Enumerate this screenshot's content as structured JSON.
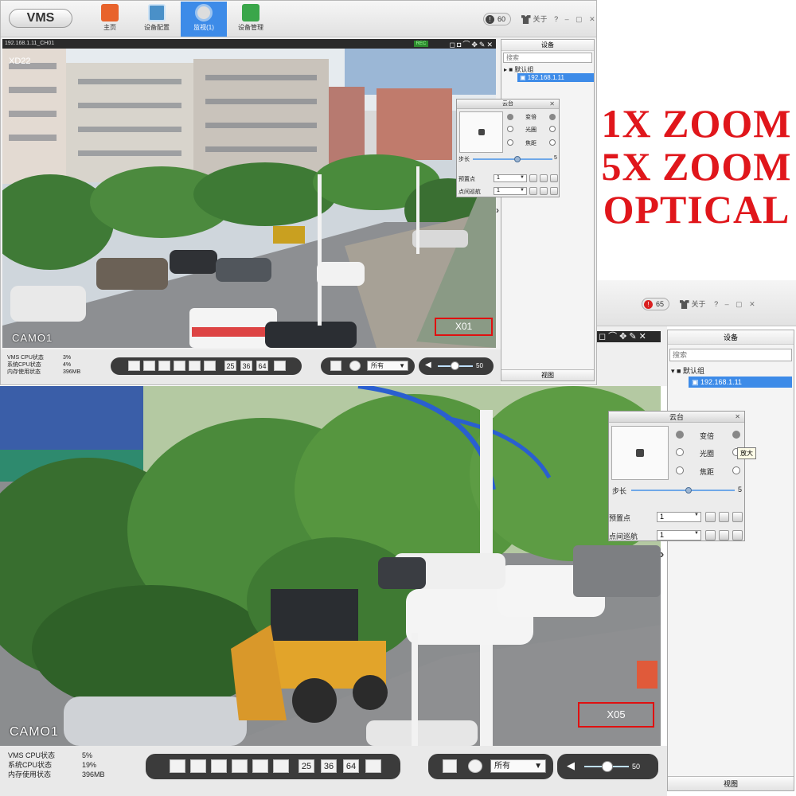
{
  "headline": {
    "line1": "1X ZOOM",
    "line2": "5X ZOOM",
    "line3": "OPTICAL"
  },
  "app": {
    "logo": "VMS"
  },
  "nav": {
    "home": "主页",
    "device_config": "设备配置",
    "preview": "监视(1)",
    "device_manage": "设备管理"
  },
  "win1": {
    "badge_count": "60",
    "about": "关于",
    "help": "?",
    "video_title": "192.168.1.11_CH01",
    "rec_label": "REC",
    "timestamp": "XD22",
    "cam_label": "CAMO1",
    "zoom_label": "X01",
    "device_title": "设备",
    "search_placeholder": "搜索",
    "group": "默认组",
    "device_item": "192.168.1.11",
    "stats": {
      "cpu_label": "VMS CPU状态",
      "cpu": "3%",
      "sys_label": "系统CPU状态",
      "sys": "4%",
      "mem_label": "内存使用状态",
      "mem": "396MB"
    },
    "grid_nums": [
      "25",
      "36",
      "64"
    ],
    "select_value": "所有",
    "volume": "50"
  },
  "win2": {
    "badge_count": "65",
    "about": "关于",
    "help": "?",
    "cam_label": "CAMO1",
    "zoom_label": "X05",
    "device_title": "设备",
    "search_placeholder": "搜索",
    "group": "默认组",
    "device_item": "192.168.1.11",
    "footer": "视图",
    "tooltip": "放大",
    "stats": {
      "cpu_label": "VMS CPU状态",
      "cpu": "5%",
      "sys_label": "系统CPU状态",
      "sys": "19%",
      "mem_label": "内存使用状态",
      "mem": "396MB"
    },
    "grid_nums": [
      "25",
      "36",
      "64"
    ],
    "select_value": "所有",
    "volume": "50"
  },
  "ptz": {
    "title": "云台",
    "zoom": "变倍",
    "iris": "光圈",
    "focus": "焦距",
    "step_label": "步长",
    "step_value": "5",
    "preset_label": "预置点",
    "preset_value": "1",
    "cruise_label": "点间巡航",
    "cruise_value": "1"
  },
  "footer_small": "视图",
  "colors": {
    "accent": "#3d8be8",
    "headline": "#e0161b",
    "zoom_box": "#e01010"
  }
}
